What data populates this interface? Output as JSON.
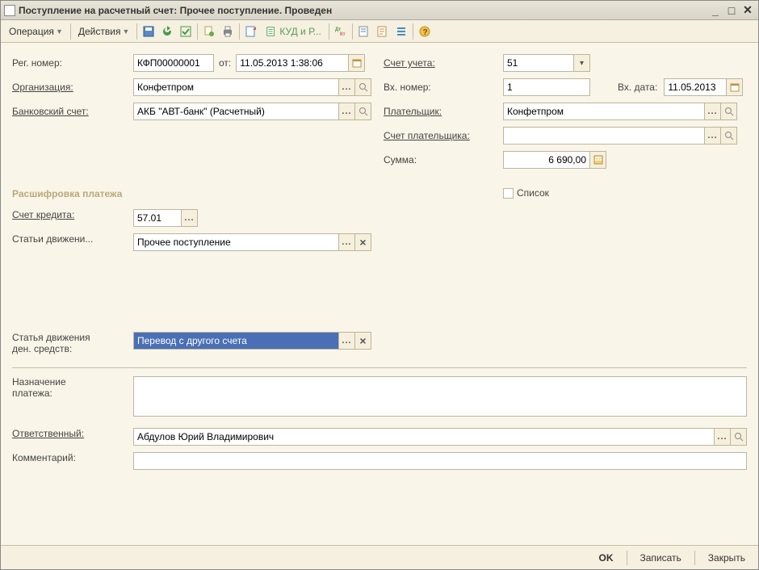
{
  "title": "Поступление на расчетный счет: Прочее поступление. Проведен",
  "menus": {
    "operation": "Операция",
    "actions": "Действия"
  },
  "toolbar": {
    "kudr": "КУД и Р..."
  },
  "left": {
    "reg_label": "Рег. номер:",
    "reg_value": "КФП00000001",
    "ot_label": "от:",
    "ot_value": "11.05.2013  1:38:06",
    "org_label": "Организация:",
    "org_value": "Конфетпром",
    "bank_label": "Банковский счет:",
    "bank_value": "АКБ \"АВТ-банк\" (Расчетный)"
  },
  "right": {
    "acct_label": "Счет учета:",
    "acct_value": "51",
    "vx_num_label": "Вх. номер:",
    "vx_num_value": "1",
    "vx_date_label": "Вх. дата:",
    "vx_date_value": "11.05.2013",
    "payer_label": "Плательщик:",
    "payer_value": "Конфетпром",
    "payer_acct_label": "Счет плательщика:",
    "payer_acct_value": "",
    "sum_label": "Сумма:",
    "sum_value": "6 690,00",
    "list_label": "Список"
  },
  "section": {
    "title": "Расшифровка платежа",
    "credit_label": "Счет кредита:",
    "credit_value": "57.01",
    "move_label": "Статьи движени...",
    "move_value": "Прочее поступление",
    "cash_label1": "Статья движения",
    "cash_label2": "ден. средств:",
    "cash_value": "Перевод с другого счета"
  },
  "bottom": {
    "purpose_label1": "Назначение",
    "purpose_label2": "платежа:",
    "purpose_value": "",
    "resp_label": "Ответственный:",
    "resp_value": "Абдулов Юрий Владимирович",
    "comment_label": "Комментарий:",
    "comment_value": ""
  },
  "buttons": {
    "ok": "OK",
    "save": "Записать",
    "close": "Закрыть"
  }
}
